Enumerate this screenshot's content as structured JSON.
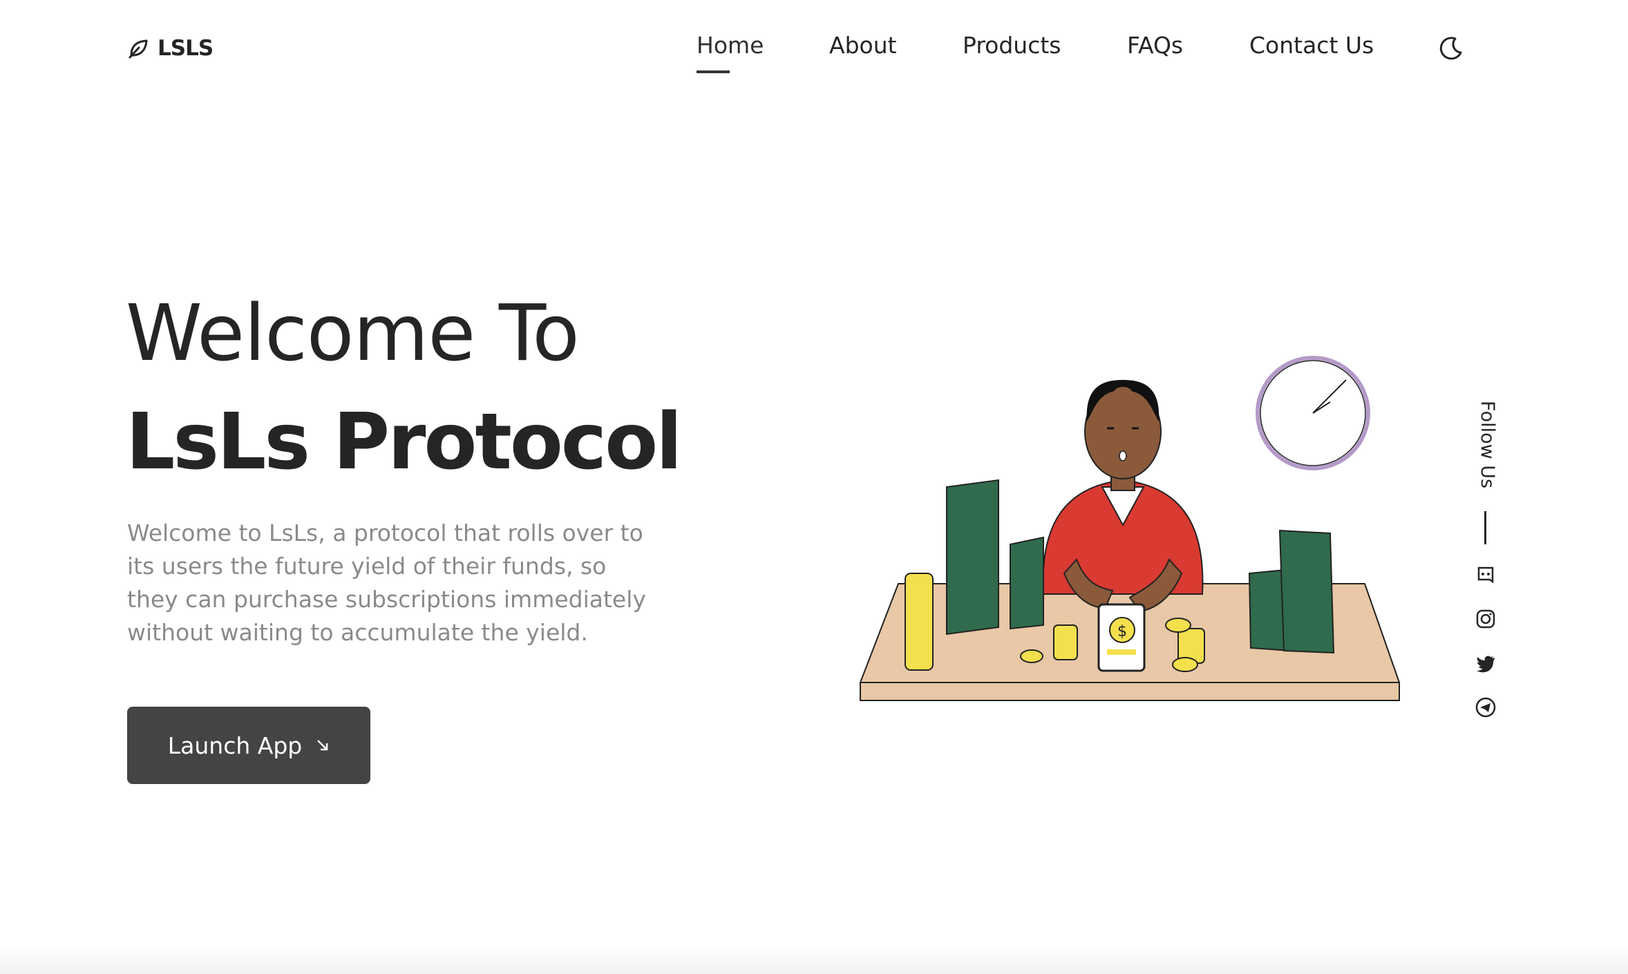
{
  "header": {
    "logo_text": "LSLS",
    "nav": [
      {
        "label": "Home",
        "active": true
      },
      {
        "label": "About"
      },
      {
        "label": "Products"
      },
      {
        "label": "FAQs"
      },
      {
        "label": "Contact Us"
      }
    ],
    "theme_toggle_icon": "moon-icon"
  },
  "hero": {
    "title_line1": "Welcome To",
    "title_line2": "LsLs Protocol",
    "description": "Welcome to LsLs, a protocol that rolls over to its users the future yield of their funds, so they can purchase subscriptions immediately without waiting to accumulate the yield.",
    "cta_label": "Launch App",
    "cta_icon": "arrow-down-right-icon"
  },
  "social": {
    "label": "Follow Us",
    "icons": [
      "discord-icon",
      "instagram-icon",
      "twitter-icon",
      "telegram-icon"
    ]
  },
  "colors": {
    "text": "#252525",
    "muted": "#8a8a8a",
    "button": "#444444",
    "sweater": "#d93a31",
    "money": "#2f6b4c",
    "coin": "#f4e04d",
    "desk": "#e8c8a6",
    "clock_ring": "#b49ac8"
  }
}
